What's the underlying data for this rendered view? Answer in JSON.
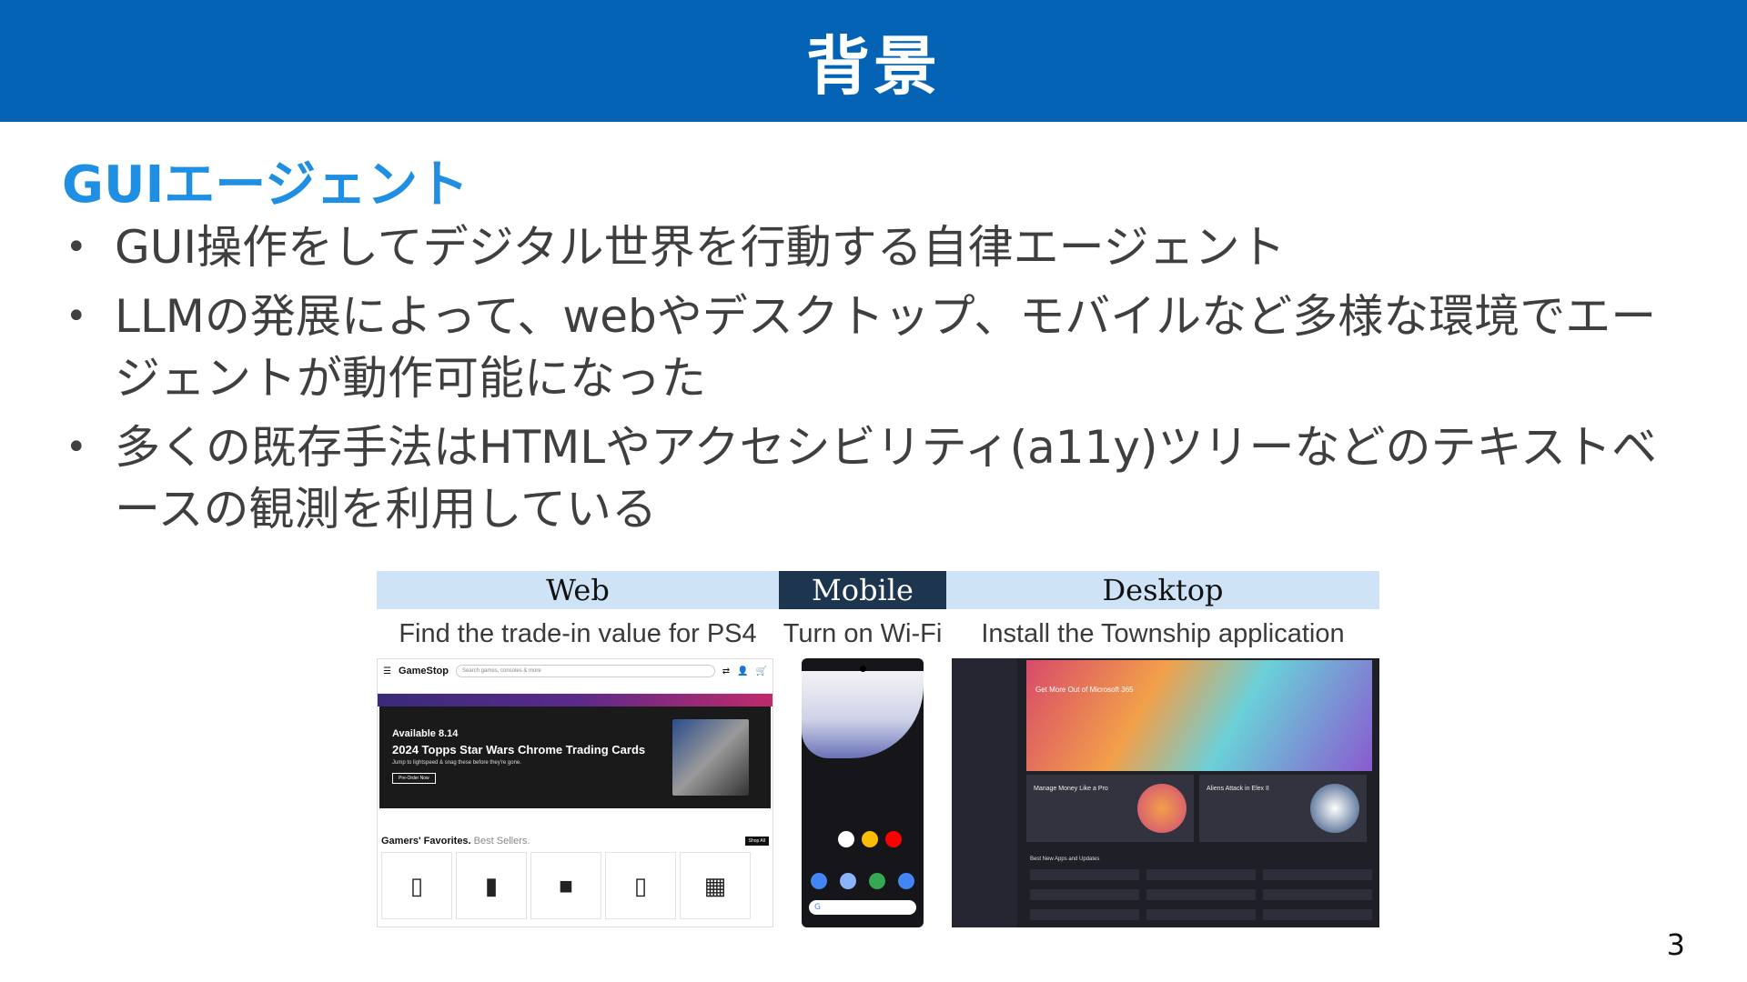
{
  "slide": {
    "title": "背景",
    "heading": "GUIエージェント",
    "bullets": [
      "GUI操作をしてデジタル世界を行動する自律エージェント",
      "LLMの発展によって、webやデスクトップ、モバイルなど多様な環境でエージェントが動作可能になった",
      "多くの既存手法はHTMLやアクセシビリティ(a11y)ツリーなどのテキストベースの観測を利用している"
    ],
    "bullet_marker": "•",
    "page_number": "3"
  },
  "figure": {
    "web": {
      "header": "Web",
      "task": "Find the trade-in value for PS4",
      "screenshot": {
        "logo": "GameStop",
        "search_placeholder": "Search games, consoles & more",
        "banner_line1": "Available 8.14",
        "banner_line2": "2024 Topps Star Wars Chrome Trading Cards",
        "banner_line3": "Jump to lightspeed & snag these before they're gone.",
        "banner_button": "Pre-Order Now",
        "section_title": "Gamers' Favorites.",
        "section_subtitle": "Best Sellers.",
        "shop_all": "Shop All"
      }
    },
    "mobile": {
      "header": "Mobile",
      "task": "Turn on Wi-Fi"
    },
    "desktop": {
      "header": "Desktop",
      "task": "Install the Township application",
      "screenshot": {
        "hero_text": "Get More Out of Microsoft 365",
        "card1": "Manage Money Like a Pro",
        "card2": "Aliens Attack in Elex II",
        "list_title": "Best New Apps and Updates"
      }
    }
  },
  "colors": {
    "title_bar": "#0563b5",
    "heading": "#1f8fe4",
    "web_header_bg": "#cfe3f6",
    "mobile_header_bg": "#1e3550"
  }
}
